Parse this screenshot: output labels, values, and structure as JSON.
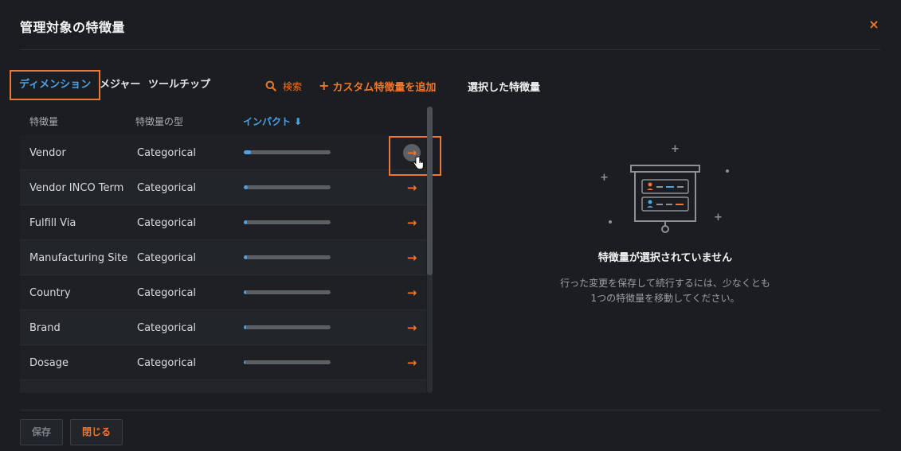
{
  "dialog": {
    "title": "管理対象の特徴量",
    "close_icon": "×"
  },
  "tabs": [
    {
      "label": "ディメンション",
      "active": true
    },
    {
      "label": "メジャー",
      "active": false
    },
    {
      "label": "ツールチップ",
      "active": false
    }
  ],
  "toolbar": {
    "search_label": "検索",
    "add_custom_label": "カスタム特徴量を追加",
    "add_icon": "+"
  },
  "table": {
    "columns": [
      "特徴量",
      "特徴量の型",
      "インパクト ⬇"
    ],
    "rows": [
      {
        "name": "Vendor",
        "type": "Categorical",
        "impact": 0.08
      },
      {
        "name": "Vendor INCO Term",
        "type": "Categorical",
        "impact": 0.05
      },
      {
        "name": "Fulfill Via",
        "type": "Categorical",
        "impact": 0.04
      },
      {
        "name": "Manufacturing Site",
        "type": "Categorical",
        "impact": 0.04
      },
      {
        "name": "Country",
        "type": "Categorical",
        "impact": 0.03
      },
      {
        "name": "Brand",
        "type": "Categorical",
        "impact": 0.03
      },
      {
        "name": "Dosage",
        "type": "Categorical",
        "impact": 0.02
      },
      {
        "name": "",
        "type": "",
        "impact": 0.0
      }
    ],
    "arrow_icon": "→"
  },
  "selected_panel": {
    "title": "選択した特徴量",
    "empty_title": "特徴量が選択されていません",
    "empty_desc": "行った変更を保存して続行するには、少なくとも1つの特徴量を移動してください。"
  },
  "footer": {
    "save_label": "保存",
    "close_label": "閉じる"
  },
  "colors": {
    "accent": "#f0772b",
    "blue": "#4aa3e8",
    "background": "#1b1d21"
  }
}
